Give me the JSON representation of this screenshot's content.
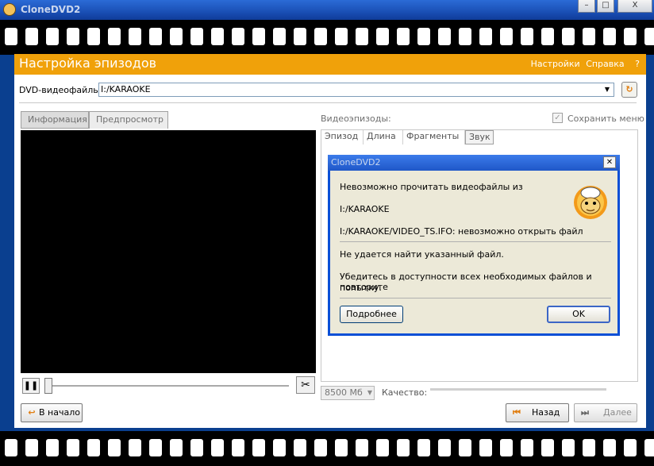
{
  "window": {
    "title": "CloneDVD2",
    "minimize": "–",
    "maximize": "□",
    "close": "X"
  },
  "header": {
    "title": "Настройка эпизодов",
    "settings_link": "Настройки",
    "help_link": "Справка",
    "question": "?"
  },
  "source": {
    "label": "DVD-видеофайлы:",
    "value": "I:/KARAOKE"
  },
  "tabs": [
    {
      "label": "Информация"
    },
    {
      "label": "Предпросмотр"
    }
  ],
  "episodes": {
    "label": "Видеоэпизоды:",
    "save_menu_label": "Сохранить меню",
    "save_menu_checked": true,
    "columns": [
      "Эпизод",
      "Длина",
      "Фрагменты",
      "Звук"
    ]
  },
  "bottom": {
    "size_value": "8500 Мб",
    "quality_label": "Качество:"
  },
  "nav": {
    "start": "В начало",
    "back": "Назад",
    "next": "Далее"
  },
  "dialog": {
    "title": "CloneDVD2",
    "line1": "Невозможно прочитать видеофайлы из",
    "line2": "I:/KARAOKE",
    "line3": "I:/KARAOKE/VIDEO_TS.IFO: невозможно открыть файл",
    "line4": "Не удается найти указанный файл.",
    "line5a": "Убедитесь в доступности всех необходимых файлов и повторите",
    "line5b": "попытку.",
    "details_button": "Подробнее",
    "ok_button": "OK"
  },
  "colors": {
    "accent": "#f0a10a",
    "titlebar": "#1f57c8",
    "filmstrip": "#000000"
  }
}
